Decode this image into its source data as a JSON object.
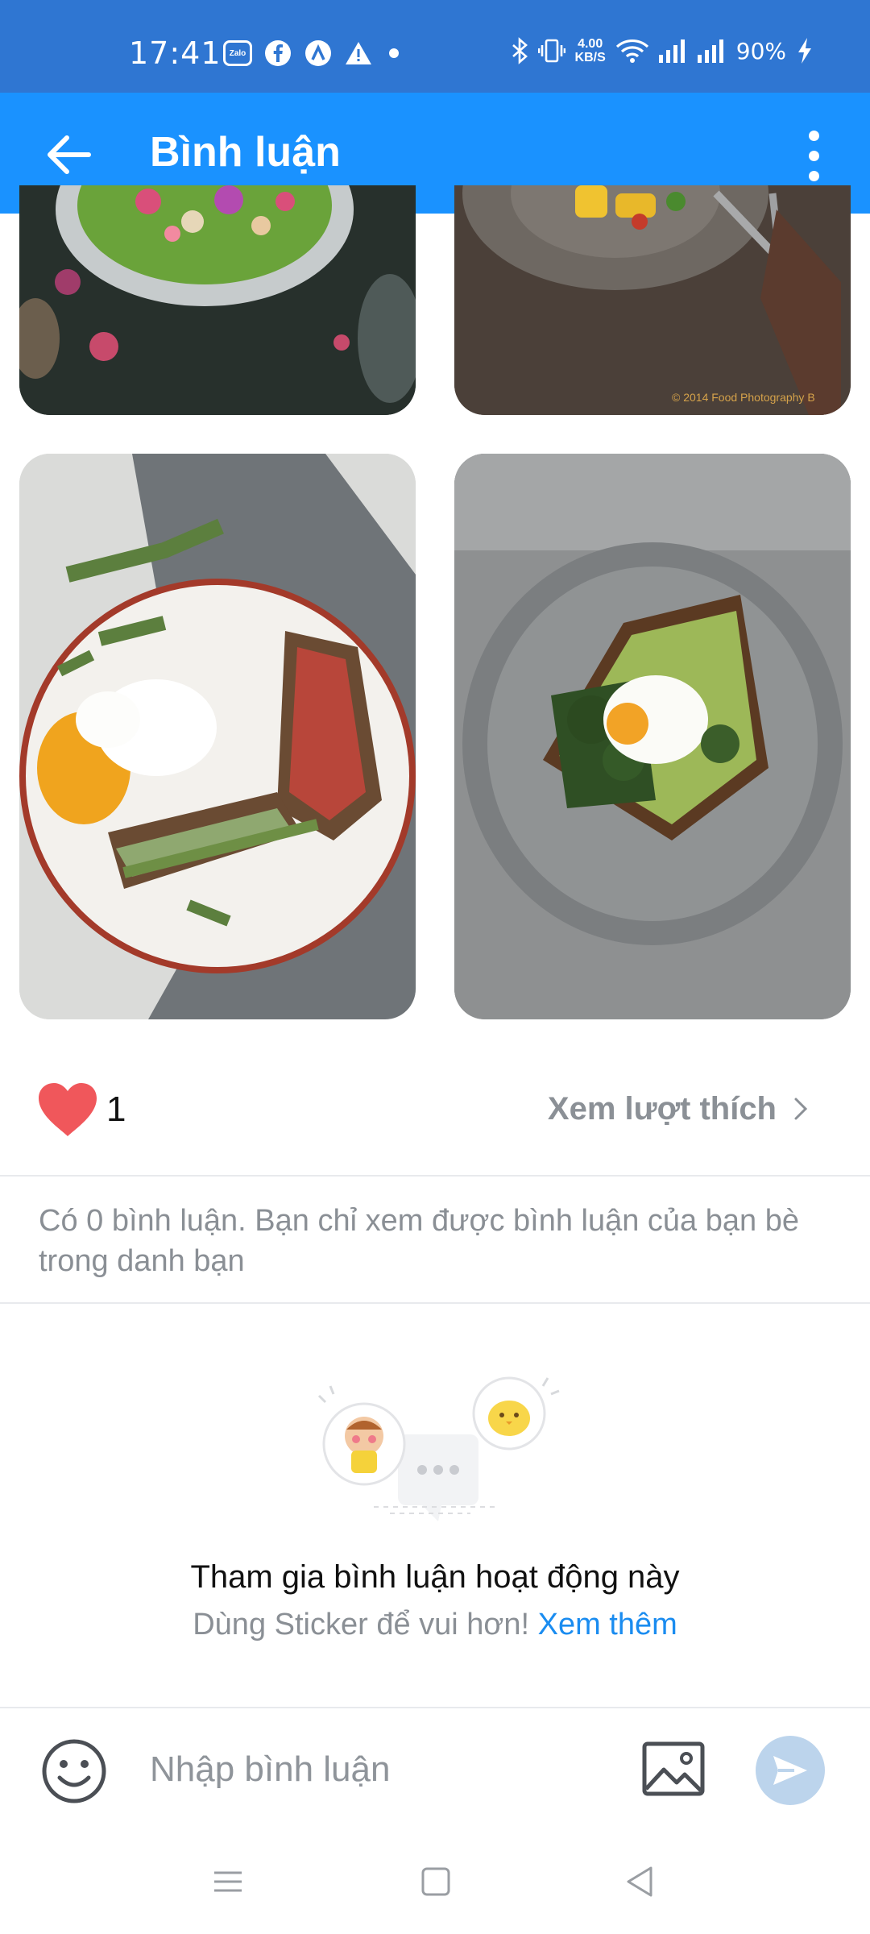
{
  "status_bar": {
    "time": "17:41",
    "speed_value": "4.00",
    "speed_unit": "KB/S",
    "battery": "90%",
    "left_icons": [
      "zalo-icon",
      "facebook-icon",
      "app-icon",
      "warning-icon",
      "dot-icon"
    ],
    "zalo_text": "Zalo",
    "right_icons": [
      "bluetooth-icon",
      "vibrate-icon",
      "wifi-icon",
      "signal-icon",
      "signal-icon",
      "charging-icon"
    ]
  },
  "app_bar": {
    "title": "Bình luận",
    "back_icon": "arrow-left-icon",
    "more_icon": "more-vertical-icon"
  },
  "photos": [
    {
      "name": "salad-bowl-photo"
    },
    {
      "name": "pasta-plate-photo",
      "watermark": "© 2014 Food Photography B"
    },
    {
      "name": "egg-toast-plate-photo"
    },
    {
      "name": "avocado-toast-photo"
    }
  ],
  "likes": {
    "count": "1",
    "see_likes_label": "Xem lượt thích",
    "heart_color": "#f0575b"
  },
  "comments_info": "Có 0 bình luận. Bạn chỉ xem được bình luận của bạn bè trong danh bạn",
  "empty_state": {
    "title": "Tham gia bình luận hoạt động này",
    "subtitle": "Dùng Sticker để vui hơn!",
    "link": "Xem thêm"
  },
  "composer": {
    "placeholder": "Nhập bình luận",
    "emoji_icon": "smiley-icon",
    "image_icon": "image-icon",
    "send_icon": "send-icon"
  },
  "colors": {
    "status_bar": "#2f76d2",
    "app_bar": "#1a92ff",
    "link": "#1a8cf0",
    "send_disabled": "#bcd4ec"
  }
}
